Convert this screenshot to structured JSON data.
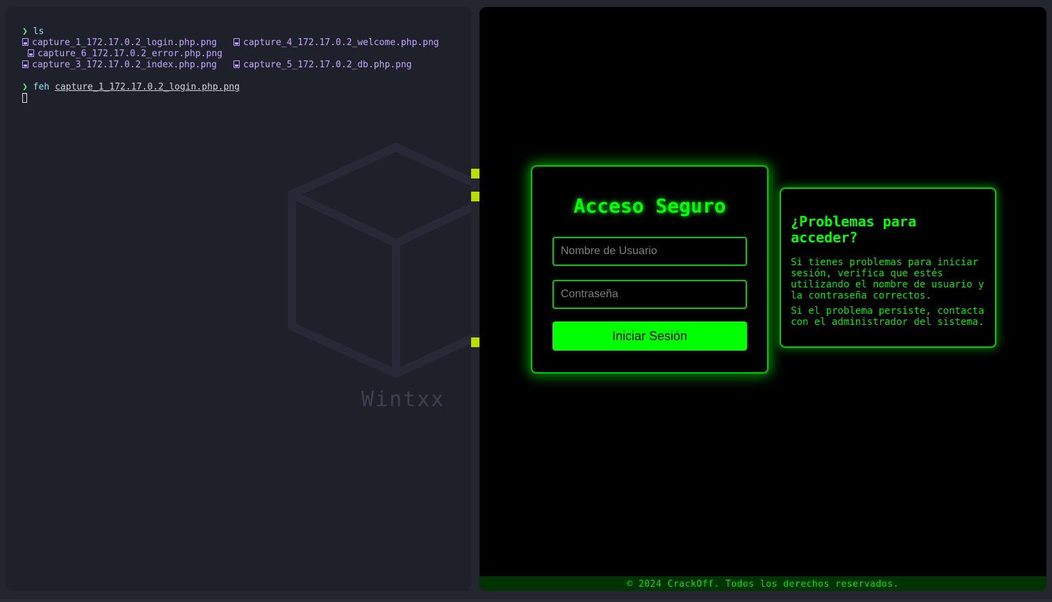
{
  "terminal": {
    "prompt_symbol": "❯",
    "command1": "ls",
    "files_row1": [
      "capture_1_172.17.0.2_login.php.png",
      "capture_4_172.17.0.2_welcome.php.png"
    ],
    "files_row2": [
      "capture_6_172.17.0.2_error.php.png"
    ],
    "files_row3": [
      "capture_3_172.17.0.2_index.php.png",
      "capture_5_172.17.0.2_db.php.png"
    ],
    "command2": "feh",
    "command2_arg": "capture_1_172.17.0.2_login.php.png",
    "wallpaper_text": "Wintxx"
  },
  "viewer": {
    "login": {
      "title": "Acceso Seguro",
      "username_placeholder": "Nombre de Usuario",
      "password_placeholder": "Contraseña",
      "submit_label": "Iniciar Sesión"
    },
    "help": {
      "title": "¿Problemas para acceder?",
      "paragraph1": "Si tienes problemas para iniciar sesión, verifica que estés utilizando el nombre de usuario y la contraseña correctos.",
      "paragraph2": "Si el problema persiste, contacta con el administrador del sistema."
    },
    "footer": "© 2024 CrackOff. Todos los derechos reservados."
  },
  "colors": {
    "terminal_bg": "#1e202a",
    "neon_green": "#00ff00",
    "file_purple": "#c3a6ff",
    "prompt_green": "#50fa7b"
  }
}
